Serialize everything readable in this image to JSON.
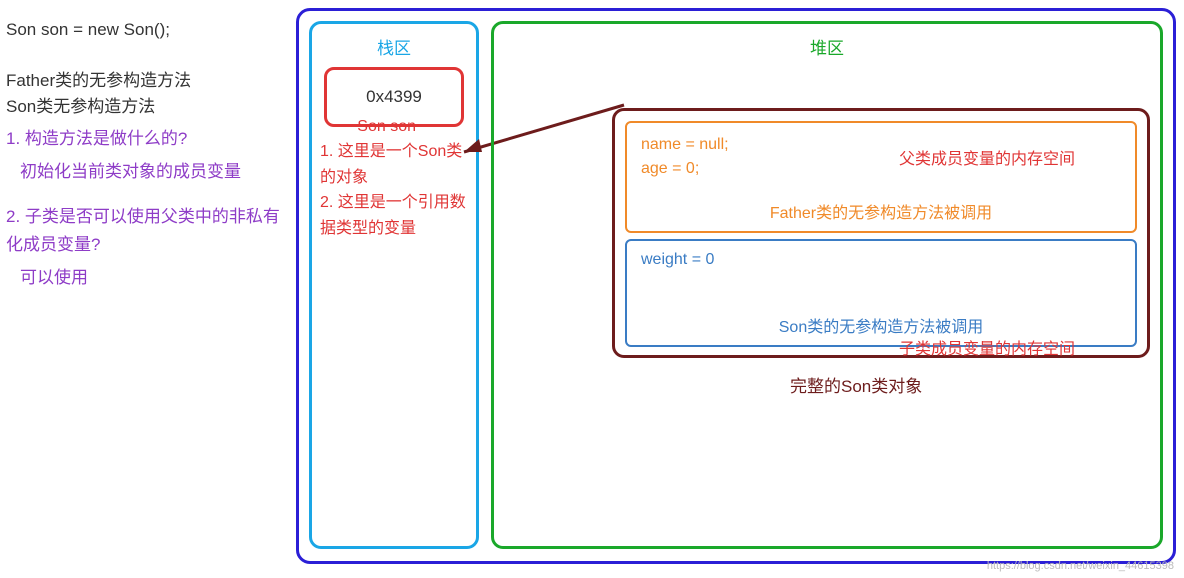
{
  "left": {
    "code": "Son son = new Son();",
    "line1": "Father类的无参构造方法",
    "line2": "Son类无参构造方法",
    "q1": "1. 构造方法是做什么的?",
    "a1": "初始化当前类对象的成员变量",
    "q2": "2. 子类是否可以使用父类中的非私有化成员变量?",
    "a2": "可以使用"
  },
  "stack": {
    "title": "栈区",
    "var_label": "Son son",
    "address": "0x4399",
    "note1": "1. 这里是一个Son类的对象",
    "note2": "2. 这里是一个引用数据类型的变量"
  },
  "heap": {
    "title": "堆区",
    "father": {
      "var1": "name = null;",
      "var2": "age = 0;",
      "label": "父类成员变量的内存空间",
      "ctor": "Father类的无参构造方法被调用"
    },
    "son": {
      "var1": "weight = 0",
      "label": "子类成员变量的内存空间",
      "ctor": "Son类的无参构造方法被调用"
    },
    "full_obj": "完整的Son类对象"
  },
  "watermark": "https://blog.csdn.net/weixin_44615398"
}
